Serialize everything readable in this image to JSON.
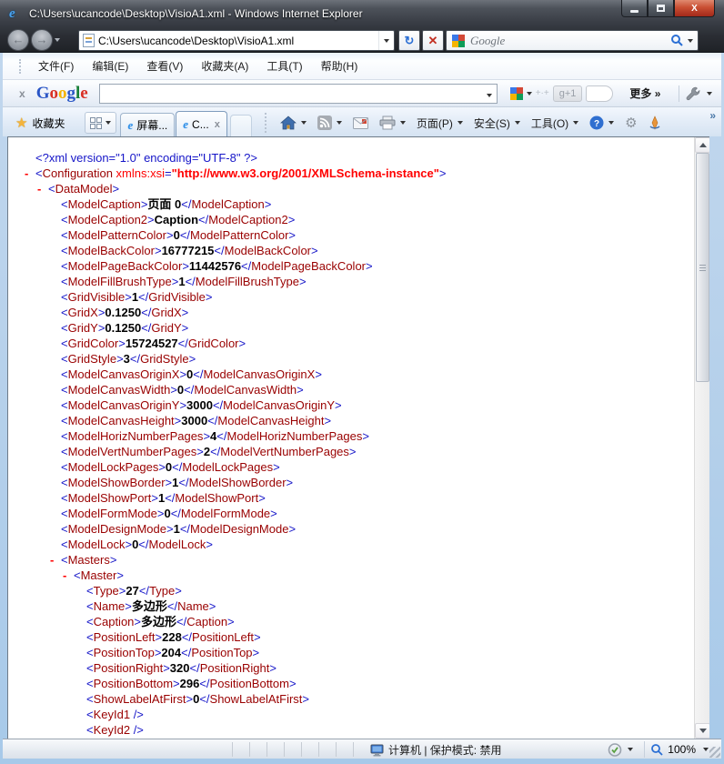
{
  "window": {
    "title": "C:\\Users\\ucancode\\Desktop\\VisioA1.xml - Windows Internet Explorer"
  },
  "nav": {
    "address": "C:\\Users\\ucancode\\Desktop\\VisioA1.xml",
    "search_placeholder": "Google"
  },
  "icons": {
    "ie_logo": "e",
    "back_arrow": "←",
    "forward_arrow": "→",
    "refresh": "↻",
    "stop": "✕",
    "google_close": "x",
    "favorites_star": "★",
    "tab_close": "x",
    "gear": "⚙",
    "chevron_more": "»",
    "plus_dots": "+·+"
  },
  "menu": {
    "items": [
      "文件(F)",
      "编辑(E)",
      "查看(V)",
      "收藏夹(A)",
      "工具(T)",
      "帮助(H)"
    ]
  },
  "google_toolbar": {
    "logo_letters": [
      {
        "ch": "G",
        "color": "#2a56c6"
      },
      {
        "ch": "o",
        "color": "#d93025"
      },
      {
        "ch": "o",
        "color": "#f4b400"
      },
      {
        "ch": "g",
        "color": "#2a56c6"
      },
      {
        "ch": "l",
        "color": "#188038"
      },
      {
        "ch": "e",
        "color": "#d93025"
      }
    ],
    "plus_one_label": "g+1",
    "more_label": "更多 »"
  },
  "tab_bar": {
    "favorites_label": "收藏夹",
    "tabs": [
      {
        "label": "屏幕...",
        "active": false,
        "closable": false
      },
      {
        "label": "C...",
        "active": true,
        "closable": true
      }
    ]
  },
  "command_bar": {
    "page_label": "页面(P)",
    "security_label": "安全(S)",
    "tools_label": "工具(O)"
  },
  "status_bar": {
    "zone_text": "计算机 | 保护模式: 禁用",
    "zoom_level": "100%"
  },
  "xml": {
    "syntax": {
      "lt": "<",
      "gt": ">",
      "ltc": "</",
      "sc": " />",
      "eq": "=",
      "q": "\"",
      "minus": "-",
      "space": " "
    },
    "lines": [
      {
        "i": 0,
        "c": false,
        "t": "decl",
        "v": "<?xml version=\"1.0\" encoding=\"UTF-8\" ?>"
      },
      {
        "i": 0,
        "c": true,
        "t": "attr",
        "tag": "Configuration",
        "an": "xmlns:xsi",
        "av": "http://www.w3.org/2001/XMLSchema-instance"
      },
      {
        "i": 1,
        "c": true,
        "t": "open",
        "tag": "DataModel"
      },
      {
        "i": 2,
        "c": false,
        "t": "elem",
        "tag": "ModelCaption",
        "v": "页面 0"
      },
      {
        "i": 2,
        "c": false,
        "t": "elem",
        "tag": "ModelCaption2",
        "v": "Caption"
      },
      {
        "i": 2,
        "c": false,
        "t": "elem",
        "tag": "ModelPatternColor",
        "v": "0"
      },
      {
        "i": 2,
        "c": false,
        "t": "elem",
        "tag": "ModelBackColor",
        "v": "16777215"
      },
      {
        "i": 2,
        "c": false,
        "t": "elem",
        "tag": "ModelPageBackColor",
        "v": "11442576"
      },
      {
        "i": 2,
        "c": false,
        "t": "elem",
        "tag": "ModelFillBrushType",
        "v": "1"
      },
      {
        "i": 2,
        "c": false,
        "t": "elem",
        "tag": "GridVisible",
        "v": "1"
      },
      {
        "i": 2,
        "c": false,
        "t": "elem",
        "tag": "GridX",
        "v": "0.1250"
      },
      {
        "i": 2,
        "c": false,
        "t": "elem",
        "tag": "GridY",
        "v": "0.1250"
      },
      {
        "i": 2,
        "c": false,
        "t": "elem",
        "tag": "GridColor",
        "v": "15724527"
      },
      {
        "i": 2,
        "c": false,
        "t": "elem",
        "tag": "GridStyle",
        "v": "3"
      },
      {
        "i": 2,
        "c": false,
        "t": "elem",
        "tag": "ModelCanvasOriginX",
        "v": "0"
      },
      {
        "i": 2,
        "c": false,
        "t": "elem",
        "tag": "ModelCanvasWidth",
        "v": "0"
      },
      {
        "i": 2,
        "c": false,
        "t": "elem",
        "tag": "ModelCanvasOriginY",
        "v": "3000"
      },
      {
        "i": 2,
        "c": false,
        "t": "elem",
        "tag": "ModelCanvasHeight",
        "v": "3000"
      },
      {
        "i": 2,
        "c": false,
        "t": "elem",
        "tag": "ModelHorizNumberPages",
        "v": "4"
      },
      {
        "i": 2,
        "c": false,
        "t": "elem",
        "tag": "ModelVertNumberPages",
        "v": "2"
      },
      {
        "i": 2,
        "c": false,
        "t": "elem",
        "tag": "ModelLockPages",
        "v": "0"
      },
      {
        "i": 2,
        "c": false,
        "t": "elem",
        "tag": "ModelShowBorder",
        "v": "1"
      },
      {
        "i": 2,
        "c": false,
        "t": "elem",
        "tag": "ModelShowPort",
        "v": "1"
      },
      {
        "i": 2,
        "c": false,
        "t": "elem",
        "tag": "ModelFormMode",
        "v": "0"
      },
      {
        "i": 2,
        "c": false,
        "t": "elem",
        "tag": "ModelDesignMode",
        "v": "1"
      },
      {
        "i": 2,
        "c": false,
        "t": "elem",
        "tag": "ModelLock",
        "v": "0"
      },
      {
        "i": 2,
        "c": true,
        "t": "open",
        "tag": "Masters"
      },
      {
        "i": 3,
        "c": true,
        "t": "open",
        "tag": "Master"
      },
      {
        "i": 4,
        "c": false,
        "t": "elem",
        "tag": "Type",
        "v": "27"
      },
      {
        "i": 4,
        "c": false,
        "t": "elem",
        "tag": "Name",
        "v": "多边形"
      },
      {
        "i": 4,
        "c": false,
        "t": "elem",
        "tag": "Caption",
        "v": "多边形"
      },
      {
        "i": 4,
        "c": false,
        "t": "elem",
        "tag": "PositionLeft",
        "v": "228"
      },
      {
        "i": 4,
        "c": false,
        "t": "elem",
        "tag": "PositionTop",
        "v": "204"
      },
      {
        "i": 4,
        "c": false,
        "t": "elem",
        "tag": "PositionRight",
        "v": "320"
      },
      {
        "i": 4,
        "c": false,
        "t": "elem",
        "tag": "PositionBottom",
        "v": "296"
      },
      {
        "i": 4,
        "c": false,
        "t": "elem",
        "tag": "ShowLabelAtFirst",
        "v": "0"
      },
      {
        "i": 4,
        "c": false,
        "t": "empty",
        "tag": "KeyId1"
      },
      {
        "i": 4,
        "c": false,
        "t": "empty",
        "tag": "KeyId2"
      }
    ]
  }
}
